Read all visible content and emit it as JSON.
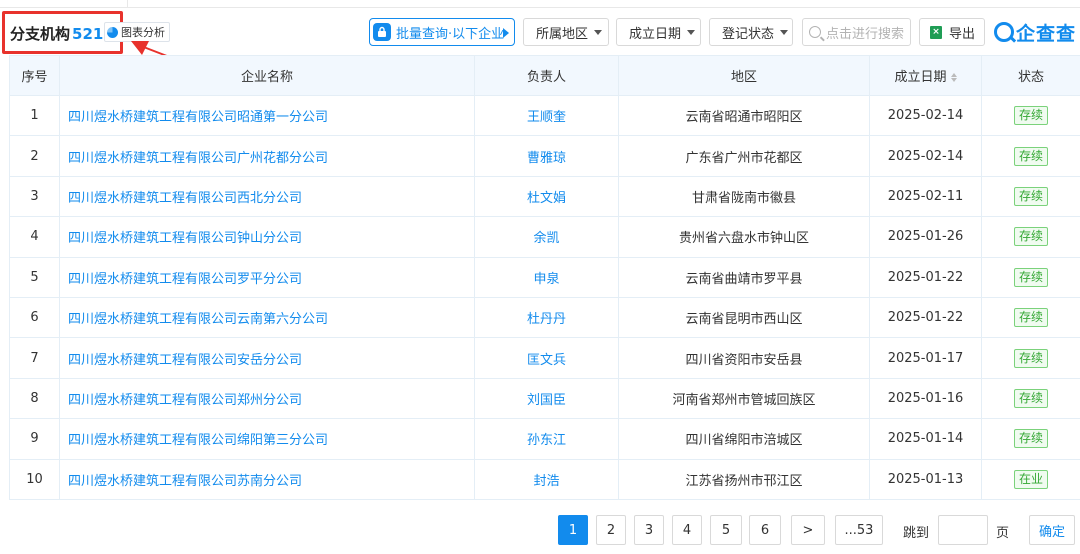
{
  "section": {
    "title": "分支机构",
    "count": "521",
    "chart_label": "图表分析"
  },
  "toolbar": {
    "batch_label": "批量查询·以下企业",
    "region_label": "所属地区",
    "date_label": "成立日期",
    "status_label": "登记状态",
    "search_placeholder": "点击进行搜索",
    "export_label": "导出",
    "brand": "企查查"
  },
  "table": {
    "headers": [
      "序号",
      "企业名称",
      "负责人",
      "地区",
      "成立日期",
      "状态"
    ],
    "rows": [
      {
        "no": "1",
        "name": "四川煜水桥建筑工程有限公司昭通第一分公司",
        "person": "王顺奎",
        "region": "云南省昭通市昭阳区",
        "date": "2025-02-14",
        "status": "存续"
      },
      {
        "no": "2",
        "name": "四川煜水桥建筑工程有限公司广州花都分公司",
        "person": "曹雅琼",
        "region": "广东省广州市花都区",
        "date": "2025-02-14",
        "status": "存续"
      },
      {
        "no": "3",
        "name": "四川煜水桥建筑工程有限公司西北分公司",
        "person": "杜文娟",
        "region": "甘肃省陇南市徽县",
        "date": "2025-02-11",
        "status": "存续"
      },
      {
        "no": "4",
        "name": "四川煜水桥建筑工程有限公司钟山分公司",
        "person": "余凯",
        "region": "贵州省六盘水市钟山区",
        "date": "2025-01-26",
        "status": "存续"
      },
      {
        "no": "5",
        "name": "四川煜水桥建筑工程有限公司罗平分公司",
        "person": "申泉",
        "region": "云南省曲靖市罗平县",
        "date": "2025-01-22",
        "status": "存续"
      },
      {
        "no": "6",
        "name": "四川煜水桥建筑工程有限公司云南第六分公司",
        "person": "杜丹丹",
        "region": "云南省昆明市西山区",
        "date": "2025-01-22",
        "status": "存续"
      },
      {
        "no": "7",
        "name": "四川煜水桥建筑工程有限公司安岳分公司",
        "person": "匡文兵",
        "region": "四川省资阳市安岳县",
        "date": "2025-01-17",
        "status": "存续"
      },
      {
        "no": "8",
        "name": "四川煜水桥建筑工程有限公司郑州分公司",
        "person": "刘国臣",
        "region": "河南省郑州市管城回族区",
        "date": "2025-01-16",
        "status": "存续"
      },
      {
        "no": "9",
        "name": "四川煜水桥建筑工程有限公司绵阳第三分公司",
        "person": "孙东江",
        "region": "四川省绵阳市涪城区",
        "date": "2025-01-14",
        "status": "存续"
      },
      {
        "no": "10",
        "name": "四川煜水桥建筑工程有限公司苏南分公司",
        "person": "封浩",
        "region": "江苏省扬州市邗江区",
        "date": "2025-01-13",
        "status": "在业"
      }
    ]
  },
  "pagination": {
    "pages": [
      "1",
      "2",
      "3",
      "4",
      "5",
      "6"
    ],
    "current": "1",
    "next": ">",
    "last": "...53",
    "jump_label": "跳到",
    "page_unit": "页",
    "confirm": "确定"
  },
  "colors": {
    "accent": "#128bed",
    "highlight": "#e8322c",
    "status_green": "#35a835"
  }
}
